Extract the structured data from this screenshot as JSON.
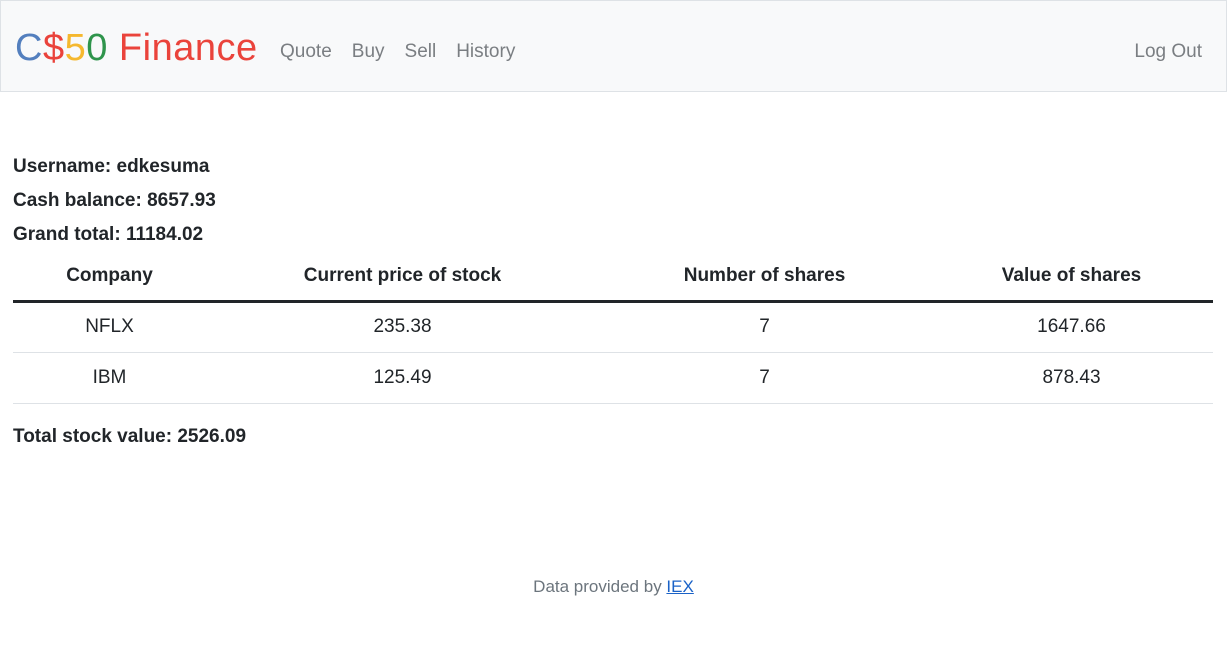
{
  "navbar": {
    "brand": {
      "part1": "C",
      "part2": "$",
      "part3": "5",
      "part4": "0",
      "part5": " Finance"
    },
    "links": [
      "Quote",
      "Buy",
      "Sell",
      "History"
    ],
    "logout": "Log Out"
  },
  "account": {
    "username_label": "Username: ",
    "username": "edkesuma",
    "cash_label": "Cash balance: ",
    "cash": "8657.93",
    "grand_label": "Grand total: ",
    "grand": "11184.02"
  },
  "table": {
    "headers": [
      "Company",
      "Current price of stock",
      "Number of shares",
      "Value of shares"
    ],
    "rows": [
      [
        "NFLX",
        "235.38",
        "7",
        "1647.66"
      ],
      [
        "IBM",
        "125.49",
        "7",
        "878.43"
      ]
    ]
  },
  "total": {
    "label": "Total stock value: ",
    "value": "2526.09"
  },
  "footer": {
    "text": "Data provided by ",
    "link": "IEX"
  },
  "colors": {
    "brand_blue": "#537fbe",
    "brand_red": "#ea433b",
    "brand_yellow": "#f5b82e",
    "brand_green": "#2e944b"
  }
}
